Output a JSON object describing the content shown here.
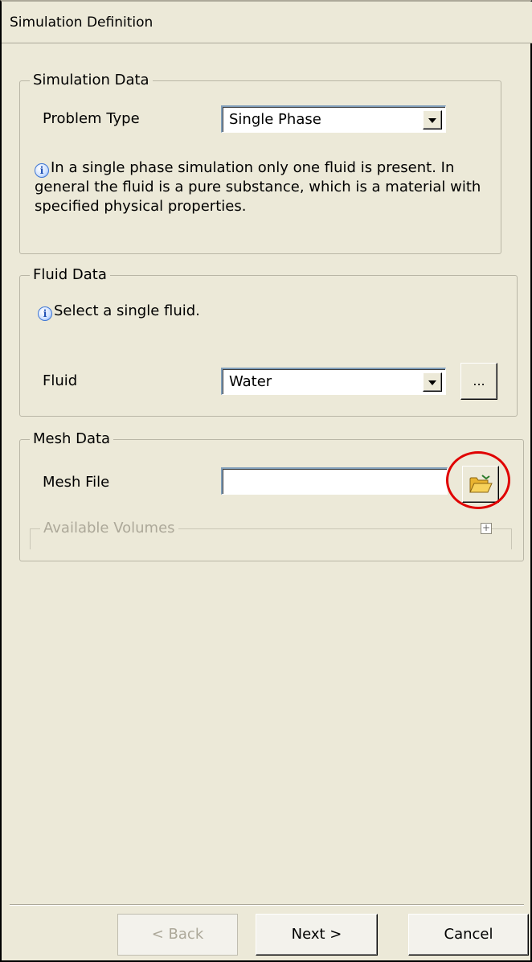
{
  "window": {
    "title": "Simulation Definition"
  },
  "simulation_data": {
    "legend": "Simulation Data",
    "problem_type_label": "Problem Type",
    "problem_type_value": "Single Phase",
    "info_line1": "In a single phase simulation only one fluid is present. In",
    "info_line2": "general the fluid is a pure substance, which is a material with",
    "info_line3": "specified physical properties."
  },
  "fluid_data": {
    "legend": "Fluid Data",
    "info": "Select a single fluid.",
    "fluid_label": "Fluid",
    "fluid_value": "Water",
    "browse_label": "..."
  },
  "mesh_data": {
    "legend": "Mesh Data",
    "mesh_file_label": "Mesh File",
    "mesh_file_value": "",
    "available_volumes_legend": "Available Volumes",
    "expand_symbol": "+"
  },
  "buttons": {
    "back": "< Back",
    "next": "Next >",
    "cancel": "Cancel"
  },
  "icons": {
    "info": "info-icon",
    "folder": "open-folder-icon",
    "dropdown": "chevron-down-icon"
  },
  "colors": {
    "background": "#ece9d8",
    "highlight": "#e00000"
  }
}
